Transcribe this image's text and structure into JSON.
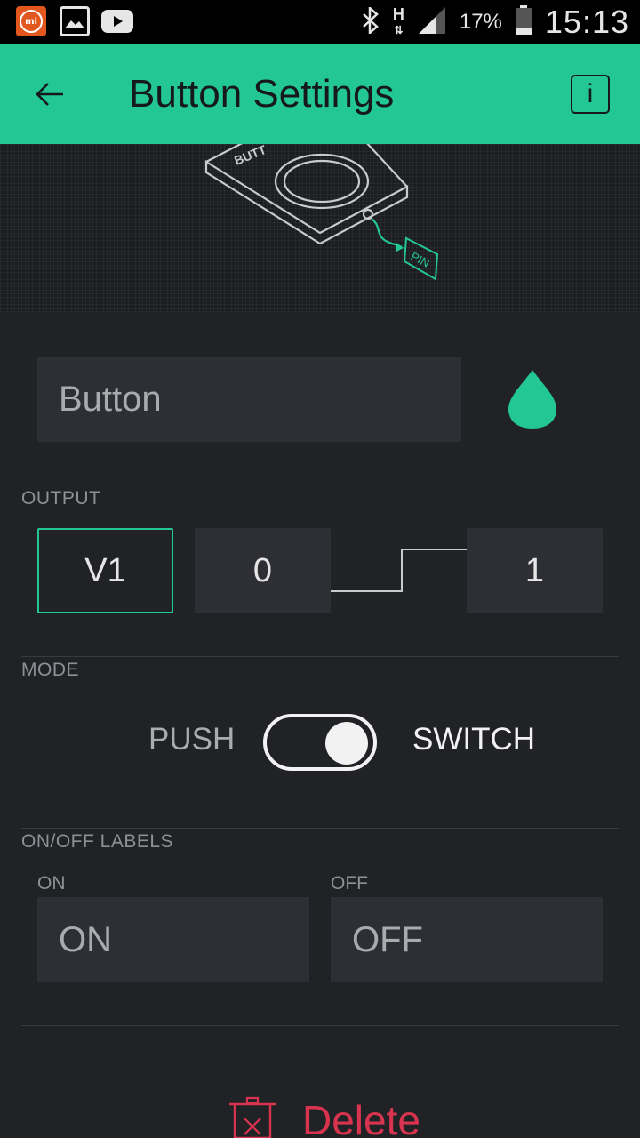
{
  "status_bar": {
    "app_icons": [
      "mi-icon",
      "gallery-icon",
      "youtube-icon"
    ],
    "network": "H",
    "battery_percent": "17%",
    "time": "15:13"
  },
  "appbar": {
    "title": "Button Settings",
    "info_label": "i"
  },
  "illustration": {
    "device_label": "BUTT",
    "pin_label": "PIN"
  },
  "widget": {
    "name_value": "Button",
    "accent_color": "#23c791"
  },
  "output": {
    "section_label": "OUTPUT",
    "pin": "V1",
    "min_value": "0",
    "max_value": "1"
  },
  "mode": {
    "section_label": "MODE",
    "push_label": "PUSH",
    "switch_label": "SWITCH",
    "selected": "SWITCH"
  },
  "onoff_labels": {
    "section_label": "ON/OFF LABELS",
    "on_caption": "ON",
    "on_value": "ON",
    "off_caption": "OFF",
    "off_value": "OFF"
  },
  "actions": {
    "delete_label": "Delete",
    "delete_color": "#d9344f"
  }
}
